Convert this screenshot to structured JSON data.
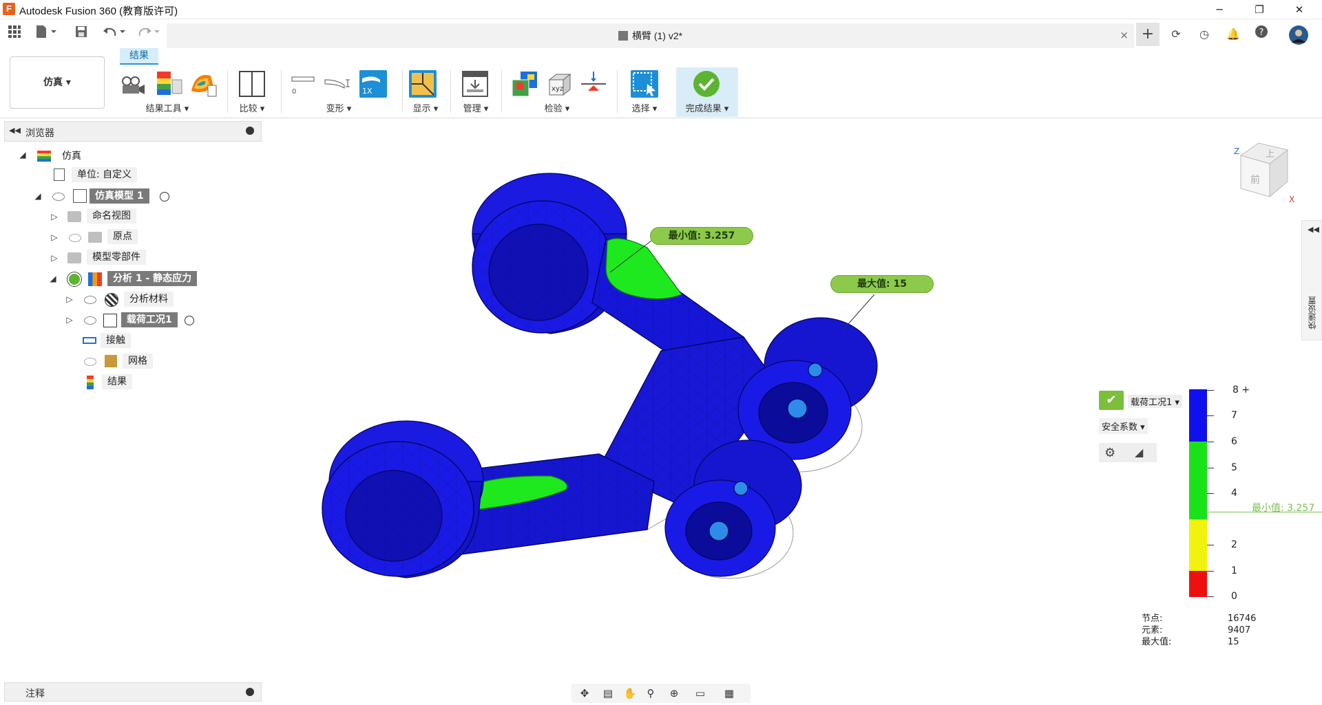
{
  "window": {
    "title": "Autodesk Fusion 360 (教育版许可)",
    "app_icon_letter": "F",
    "minimize": "─",
    "restore": "❐",
    "close": "✕"
  },
  "document_tab": {
    "title": "横臂 (1) v2*",
    "close": "×"
  },
  "workspace": {
    "label": "仿真 ▾"
  },
  "ribbon": {
    "active_tab": "结果",
    "groups": [
      {
        "label": "结果工具 ▾"
      },
      {
        "label": "比较 ▾"
      },
      {
        "label": "变形 ▾"
      },
      {
        "label": "显示 ▾"
      },
      {
        "label": "管理 ▾"
      },
      {
        "label": "检验 ▾"
      },
      {
        "label": "选择 ▾"
      },
      {
        "label": "完成结果 ▾"
      }
    ],
    "deform_scale_label": "1X",
    "xyz_label": "xyz"
  },
  "browser": {
    "title": "浏览器",
    "items": [
      {
        "label": "仿真"
      },
      {
        "label": "单位: 自定义"
      },
      {
        "label": "仿真模型 1"
      },
      {
        "label": "命名视图"
      },
      {
        "label": "原点"
      },
      {
        "label": "模型零部件"
      },
      {
        "label": "分析 1 - 静态应力"
      },
      {
        "label": "分析材料"
      },
      {
        "label": "载荷工况1"
      },
      {
        "label": "接触"
      },
      {
        "label": "网格"
      },
      {
        "label": "结果"
      }
    ]
  },
  "comments": {
    "title": "注释"
  },
  "viewport": {
    "callout_min": "最小值: 3.257",
    "callout_max": "最大值: 15",
    "viewcube": {
      "top": "上",
      "front": "前",
      "axis_z": "Z",
      "axis_x": "X"
    }
  },
  "legend": {
    "load_case": "载荷工况1 ▾",
    "result_type": "安全系数 ▾",
    "ticks": [
      "8 +",
      "7",
      "6",
      "5",
      "4",
      "2",
      "1",
      "0"
    ],
    "min_marker": "最小值: 3.257",
    "colors": {
      "blue": "#1010ee",
      "green": "#19e219",
      "yellow": "#f2f20f",
      "red": "#ee0f0f"
    }
  },
  "stats": {
    "nodes_label": "节点:",
    "nodes_value": "16746",
    "elements_label": "元素:",
    "elements_value": "9407",
    "max_label": "最大值:",
    "max_value": "15"
  },
  "sidetab": {
    "label": "快速设置"
  }
}
